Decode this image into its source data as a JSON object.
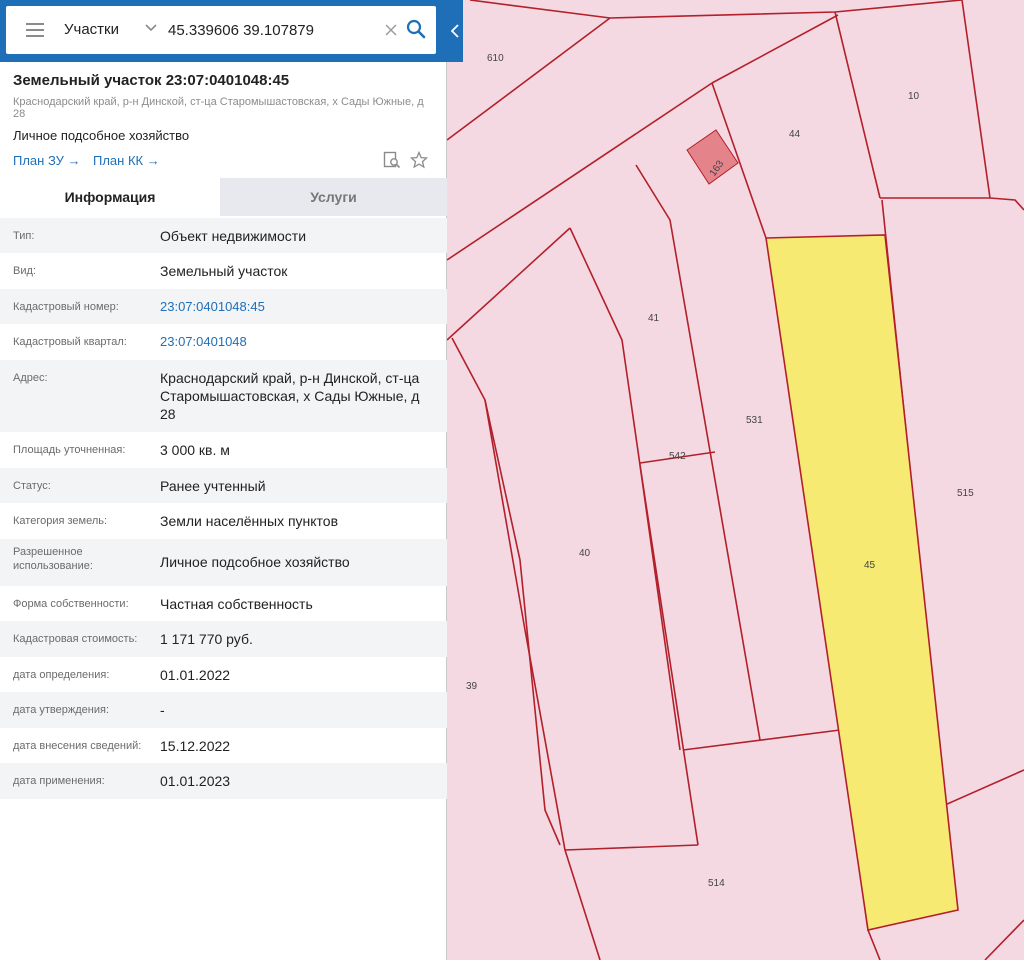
{
  "search": {
    "type_label": "Участки",
    "value": "45.339606 39.107879"
  },
  "parcel": {
    "title": "Земельный участок 23:07:0401048:45",
    "address_short": "Краснодарский край, р-н Динской, ст-ца Старомышастовская, х Сады Южные, д 28",
    "purpose": "Личное подсобное хозяйство",
    "links": {
      "plan_zu": "План ЗУ →",
      "plan_kk": "План КК →"
    }
  },
  "tabs": {
    "info": "Информация",
    "services": "Услуги"
  },
  "rows": [
    {
      "label": "Тип:",
      "value": "Объект недвижимости"
    },
    {
      "label": "Вид:",
      "value": "Земельный участок"
    },
    {
      "label": "Кадастровый номер:",
      "value": "23:07:0401048:45"
    },
    {
      "label": "Кадастровый квартал:",
      "value": "23:07:0401048"
    },
    {
      "label": "Адрес:",
      "value": "Краснодарский край, р-н Динской, ст-ца Старомышастовская, х Сады Южные, д 28"
    },
    {
      "label": "Площадь уточненная:",
      "value": "3 000 кв. м"
    },
    {
      "label": "Статус:",
      "value": "Ранее учтенный"
    },
    {
      "label": "Категория земель:",
      "value": "Земли населённых пунктов"
    },
    {
      "label": "Разрешенное использование:",
      "value": "Личное подсобное хозяйство"
    },
    {
      "label": "Форма собственности:",
      "value": "Частная собственность"
    },
    {
      "label": "Кадастровая стоимость:",
      "value": "1 171 770 руб."
    },
    {
      "label": "дата определения:",
      "value": "01.01.2022"
    },
    {
      "label": "дата утверждения:",
      "value": "-"
    },
    {
      "label": "дата внесения сведений:",
      "value": "15.12.2022"
    },
    {
      "label": "дата применения:",
      "value": "01.01.2023"
    }
  ],
  "map": {
    "labels": {
      "l610": "610",
      "l10": "10",
      "l44": "44",
      "l163": "163",
      "l41": "41",
      "l531": "531",
      "l542": "542",
      "l515": "515",
      "l45": "45",
      "l40": "40",
      "l39": "39",
      "l514": "514"
    }
  },
  "colors": {
    "accent": "#1f6fb8",
    "parcel_fill": "#f4d9e3",
    "parcel_border": "#b3202a",
    "selected_fill": "#f7ea73"
  }
}
